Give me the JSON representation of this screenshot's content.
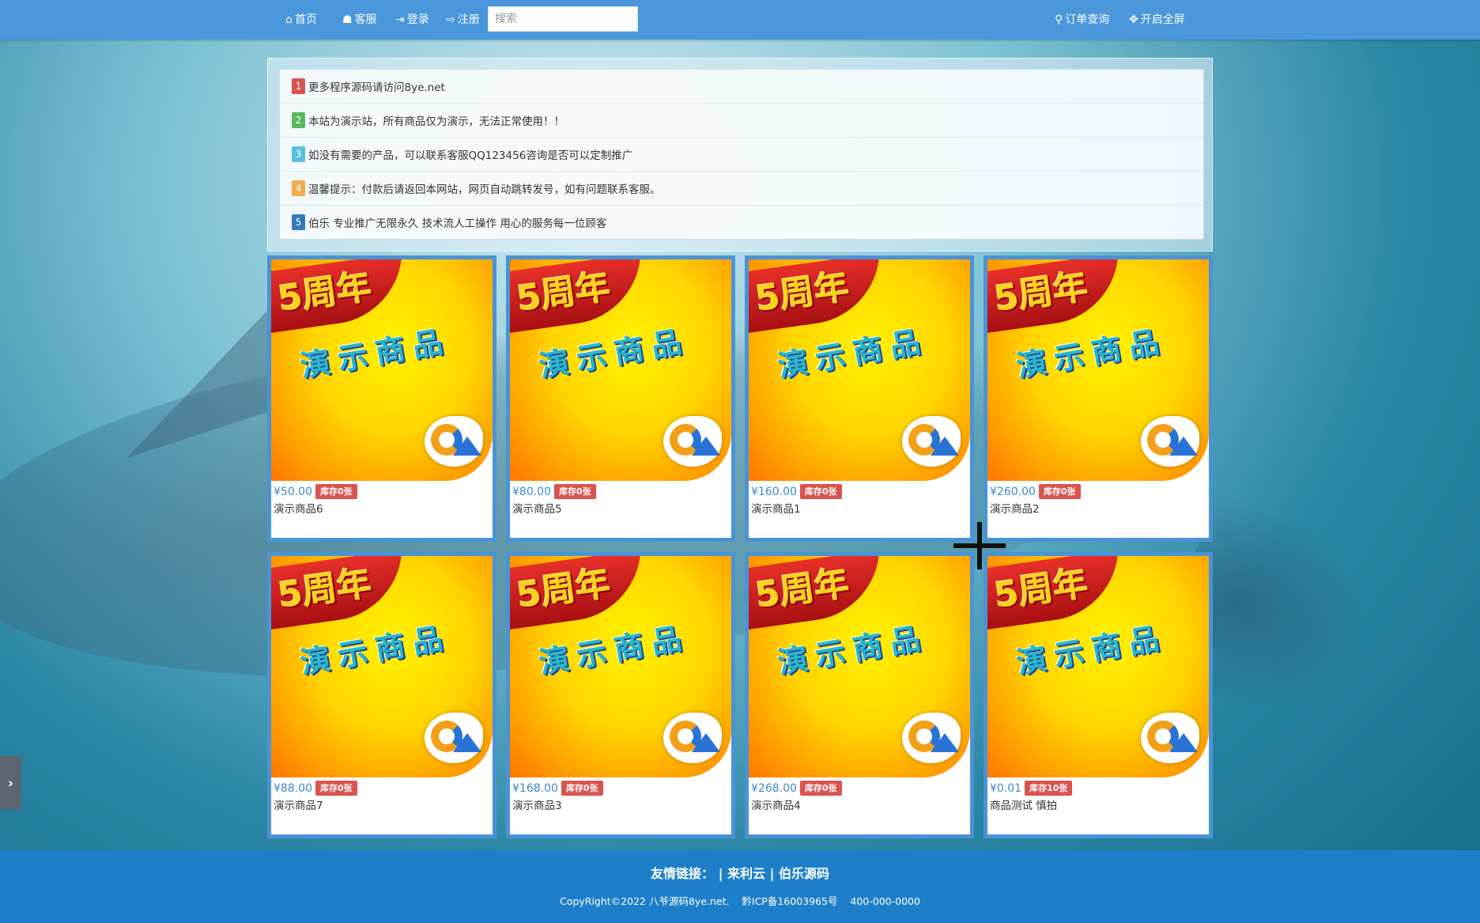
{
  "nav": {
    "home": "首页",
    "service": "客服",
    "login": "登录",
    "register": "注册",
    "search_placeholder": "搜索",
    "order_query": "订单查询",
    "fullscreen": "开启全屏"
  },
  "notices": [
    {
      "num": "1",
      "color": "#d9534f",
      "text": "更多程序源码请访问8ye.net"
    },
    {
      "num": "2",
      "color": "#5cb85c",
      "text": "本站为演示站，所有商品仅为演示，无法正常使用！！"
    },
    {
      "num": "3",
      "color": "#5bc0de",
      "text": "如没有需要的产品，可以联系客服QQ123456咨询是否可以定制推广"
    },
    {
      "num": "4",
      "color": "#f0ad4e",
      "text": "温馨提示：付款后请返回本网站，网页自动跳转发号，如有问题联系客服。"
    },
    {
      "num": "5",
      "color": "#337ab7",
      "text": "伯乐 专业推广无限永久 技术流人工操作 用心的服务每一位顾客"
    }
  ],
  "product_image": {
    "year_text": "5周年",
    "demo_text": "演示商品"
  },
  "products": [
    {
      "price": "¥50.00",
      "stock": "库存0张",
      "name": "演示商品6"
    },
    {
      "price": "¥80.00",
      "stock": "库存0张",
      "name": "演示商品5"
    },
    {
      "price": "¥160.00",
      "stock": "库存0张",
      "name": "演示商品1"
    },
    {
      "price": "¥260.00",
      "stock": "库存0张",
      "name": "演示商品2"
    },
    {
      "price": "¥88.00",
      "stock": "库存0张",
      "name": "演示商品7"
    },
    {
      "price": "¥168.00",
      "stock": "库存0张",
      "name": "演示商品3"
    },
    {
      "price": "¥268.00",
      "stock": "库存0张",
      "name": "演示商品4"
    },
    {
      "price": "¥0.01",
      "stock": "库存10张",
      "name": "商品测试 慎拍"
    }
  ],
  "footer": {
    "links_label": "友情链接：",
    "link1": "来利云",
    "link2": "伯乐源码",
    "copyright": "CopyRight©2022 八爷源码8ye.net.",
    "icp": "黔ICP备16003965号",
    "phone": "400-000-0000"
  },
  "colors": {
    "navbar": "#4a97db",
    "card_border": "#4a93d6",
    "stock_badge": "#d9534f",
    "price": "#3b87d4",
    "footer": "#1d7fca"
  }
}
